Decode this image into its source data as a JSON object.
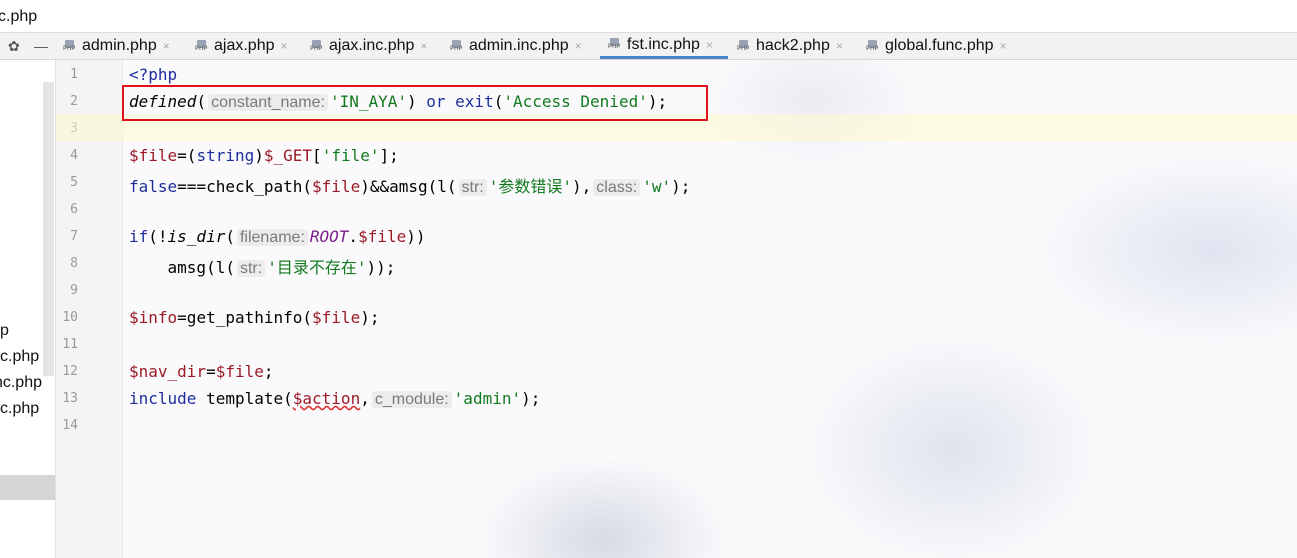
{
  "window": {
    "title_fragment": "c.php"
  },
  "toolbar": {
    "settings_glyph": "✿",
    "minimize_glyph": "—"
  },
  "tabs": [
    {
      "label": "admin.php",
      "active": false
    },
    {
      "label": "ajax.php",
      "active": false
    },
    {
      "label": "ajax.inc.php",
      "active": false
    },
    {
      "label": "admin.inc.php",
      "active": false
    },
    {
      "label": "fst.inc.php",
      "active": true
    },
    {
      "label": "hack2.php",
      "active": false
    },
    {
      "label": "global.func.php",
      "active": false
    }
  ],
  "tab_close_glyph": "×",
  "left_panel": {
    "files": [
      "p",
      "c.php",
      "nc.php",
      "c.php"
    ]
  },
  "gutter": {
    "line_numbers": [
      "1",
      "2",
      "3",
      "4",
      "5",
      "6",
      "7",
      "8",
      "9",
      "10",
      "11",
      "12",
      "13",
      "14"
    ]
  },
  "code": {
    "l1": {
      "open_tag": "<?php"
    },
    "l2": {
      "fn": "defined",
      "p1": "(",
      "hint": "constant_name:",
      "str1": "'IN_AYA'",
      "p2": ") ",
      "kw_or": "or",
      "kw_exit": " exit",
      "p3": "(",
      "str2": "'Access Denied'",
      "p4": ");"
    },
    "l4": {
      "var": "$file",
      "p1": "=(",
      "kw": "string",
      "p2": ")",
      "var2": "$_GET",
      "p3": "[",
      "str": "'file'",
      "p4": "];"
    },
    "l5": {
      "kw": "false",
      "p1": "===check_path(",
      "var": "$file",
      "p2": ")&&amsg(l(",
      "hint1": "str:",
      "str1": "'参数错误'",
      "p3": "),",
      "hint2": "class:",
      "str2": "'w'",
      "p4": ");"
    },
    "l7": {
      "kw": "if",
      "p1": "(!",
      "fn": "is_dir",
      "p2": "(",
      "hint": "filename:",
      "const": "ROOT",
      "p3": ".",
      "var": "$file",
      "p4": "))"
    },
    "l8": {
      "p1": "    amsg(l(",
      "hint": "str:",
      "str": "'目录不存在'",
      "p2": "));"
    },
    "l10": {
      "var": "$info",
      "p1": "=get_pathinfo(",
      "var2": "$file",
      "p2": ");"
    },
    "l12": {
      "var": "$nav_dir",
      "p1": "=",
      "var2": "$file",
      "p2": ";"
    },
    "l13": {
      "kw": "include",
      "p1": " template(",
      "var": "$action",
      "p2": ",",
      "hint": "c_module:",
      "str": "'admin'",
      "p3": ");"
    }
  }
}
